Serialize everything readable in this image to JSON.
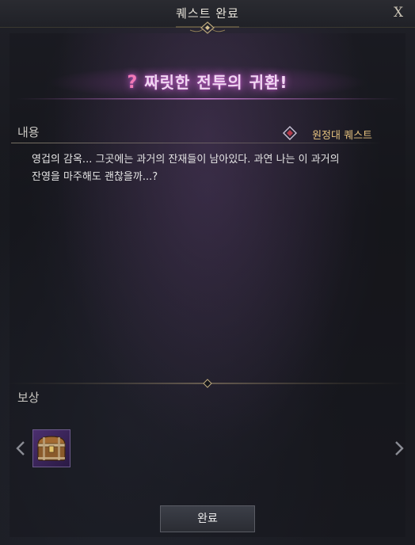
{
  "window": {
    "title": "퀘스트 완료",
    "close_label": "X"
  },
  "quest": {
    "title": "짜릿한 전투의 귀환!",
    "title_mark": "?"
  },
  "content": {
    "label": "내용",
    "quest_type": "원정대 퀘스트",
    "description_line1": "영겁의 감옥... 그곳에는 과거의 잔재들이 남아있다. 과연 나는 이 과거의",
    "description_line2": "잔영을 마주해도 괜찮을까...?"
  },
  "reward": {
    "label": "보상",
    "items": [
      {
        "icon": "treasure-chest-icon"
      }
    ]
  },
  "actions": {
    "complete_label": "완료"
  },
  "colors": {
    "quest_title_glow": "#d778dc",
    "question_mark": "#f17ab6",
    "quest_type_text": "#e6c27f",
    "reward_slot_bg": "#4b2f6e"
  }
}
